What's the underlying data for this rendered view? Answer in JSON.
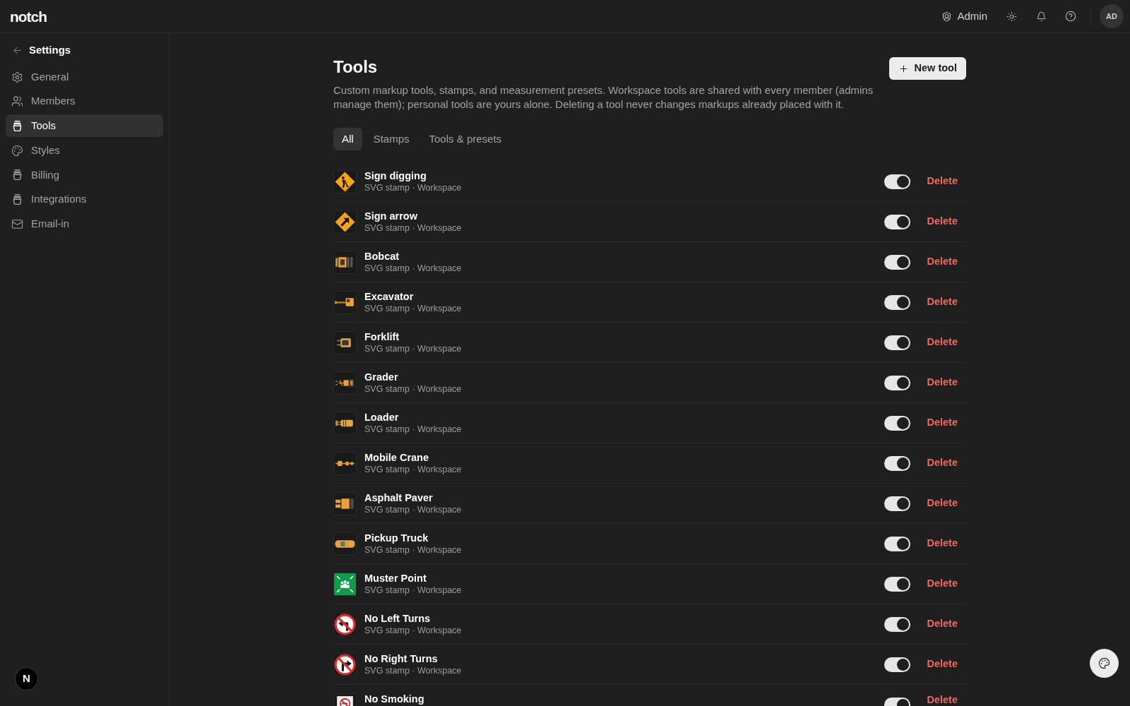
{
  "top_bar": {
    "logo": "notch",
    "role": "Admin",
    "avatar": "AD"
  },
  "sidebar": {
    "back": "Settings",
    "items": [
      {
        "label": "General",
        "selected": false
      },
      {
        "label": "Members",
        "selected": false
      },
      {
        "label": "Tools",
        "selected": true
      },
      {
        "label": "Styles",
        "selected": false
      },
      {
        "label": "Billing",
        "selected": false
      },
      {
        "label": "Integrations",
        "selected": false
      },
      {
        "label": "Email-in",
        "selected": false
      }
    ]
  },
  "page": {
    "title": "Tools",
    "description": "Custom markup tools, stamps, and measurement presets. Workspace tools are shared with every member (admins manage them); personal tools are yours alone. Deleting a tool never changes markups already placed with it.",
    "new_button": "New tool",
    "tabs": [
      {
        "label": "All",
        "selected": true
      },
      {
        "label": "Stamps",
        "selected": false
      },
      {
        "label": "Tools & presets",
        "selected": false
      }
    ],
    "tools": [
      {
        "name": "Sign digging",
        "meta": "SVG stamp · Workspace",
        "enabled": true,
        "action": "Delete"
      },
      {
        "name": "Sign arrow",
        "meta": "SVG stamp · Workspace",
        "enabled": true,
        "action": "Delete"
      },
      {
        "name": "Bobcat",
        "meta": "SVG stamp · Workspace",
        "enabled": true,
        "action": "Delete"
      },
      {
        "name": "Excavator",
        "meta": "SVG stamp · Workspace",
        "enabled": true,
        "action": "Delete"
      },
      {
        "name": "Forklift",
        "meta": "SVG stamp · Workspace",
        "enabled": true,
        "action": "Delete"
      },
      {
        "name": "Grader",
        "meta": "SVG stamp · Workspace",
        "enabled": true,
        "action": "Delete"
      },
      {
        "name": "Loader",
        "meta": "SVG stamp · Workspace",
        "enabled": true,
        "action": "Delete"
      },
      {
        "name": "Mobile Crane",
        "meta": "SVG stamp · Workspace",
        "enabled": true,
        "action": "Delete"
      },
      {
        "name": "Asphalt Paver",
        "meta": "SVG stamp · Workspace",
        "enabled": true,
        "action": "Delete"
      },
      {
        "name": "Pickup Truck",
        "meta": "SVG stamp · Workspace",
        "enabled": true,
        "action": "Delete"
      },
      {
        "name": "Muster Point",
        "meta": "SVG stamp · Workspace",
        "enabled": true,
        "action": "Delete"
      },
      {
        "name": "No Left Turns",
        "meta": "SVG stamp · Workspace",
        "enabled": true,
        "action": "Delete"
      },
      {
        "name": "No Right Turns",
        "meta": "SVG stamp · Workspace",
        "enabled": true,
        "action": "Delete"
      },
      {
        "name": "No Smoking",
        "enabled": true,
        "action": "Delete"
      }
    ]
  },
  "floating": {
    "dev_badge": "N"
  }
}
